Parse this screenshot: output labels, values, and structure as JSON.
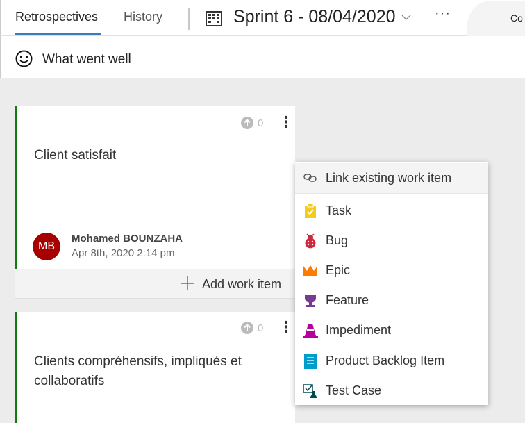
{
  "header": {
    "tabs": [
      {
        "label": "Retrospectives",
        "active": true
      },
      {
        "label": "History"
      }
    ],
    "sprint": "Sprint 6 - 08/04/2020",
    "more": "···",
    "right_tab": "Co"
  },
  "column": {
    "title": "What went well",
    "icon": "smiley-icon",
    "accent": "#107c10"
  },
  "cards": [
    {
      "text": "Client satisfait",
      "votes": "0",
      "author": "Mohamed BOUNZAHA",
      "initials": "MB",
      "date": "Apr 8th, 2020 2:14 pm",
      "add_label": "Add work item"
    },
    {
      "text": "Clients compréhensifs, impliqués et collaboratifs",
      "votes": "0"
    }
  ],
  "menu": {
    "items": [
      {
        "label": "Link existing work item",
        "icon": "link-icon"
      },
      {
        "label": "Task",
        "icon": "task-icon",
        "color": "#f2cb1d"
      },
      {
        "label": "Bug",
        "icon": "bug-icon",
        "color": "#cc293d"
      },
      {
        "label": "Epic",
        "icon": "epic-icon",
        "color": "#ff7b00"
      },
      {
        "label": "Feature",
        "icon": "feature-icon",
        "color": "#773b93"
      },
      {
        "label": "Impediment",
        "icon": "impediment-icon",
        "color": "#b4009e"
      },
      {
        "label": "Product Backlog Item",
        "icon": "backlog-item-icon",
        "color": "#009ccc"
      },
      {
        "label": "Test Case",
        "icon": "test-case-icon",
        "color": "#004b50"
      }
    ]
  }
}
